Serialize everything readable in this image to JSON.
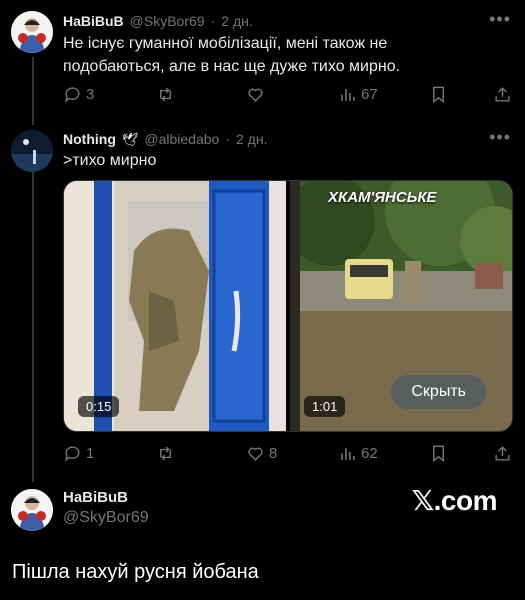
{
  "tweet1": {
    "name": "HaBiBuB",
    "handle": "@SkyBor69",
    "time": "2 дн.",
    "text_line1": "Не існує гуманної мобілізації, мені також не",
    "text_line2": "подобаються, але в нас ще дуже тихо мирно.",
    "replies": "3",
    "views": "67"
  },
  "tweet2": {
    "name": "Nothing",
    "handle": "@albiedabo",
    "time": "2 дн.",
    "text": ">тихо мирно",
    "video1_duration": "0:15",
    "video2_duration": "1:01",
    "video2_brand": "ХКАМ'ЯНСЬКЕ",
    "hide_button": "Скрыть",
    "replies": "1",
    "likes": "8",
    "views": "62"
  },
  "profile": {
    "name": "HaBiBuB",
    "handle": "@SkyBor69"
  },
  "xcom_logo": "𝕏.com",
  "footer_text": "Пішла нахуй русня йобана",
  "colors": {
    "background": "#000000",
    "text": "#e7e9ea",
    "muted": "#71767b",
    "line": "#333639"
  }
}
